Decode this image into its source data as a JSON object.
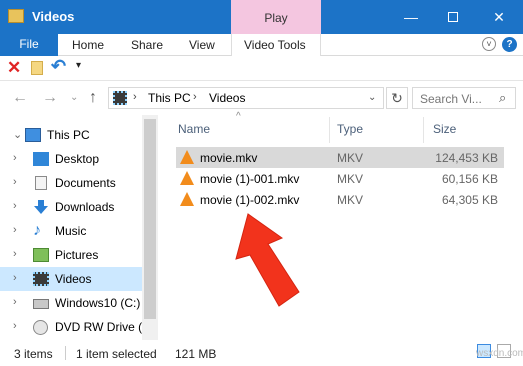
{
  "window": {
    "title": "Videos",
    "contextual_tab": "Play",
    "controls": {
      "minimize": "—",
      "close": "✕"
    }
  },
  "ribbon": {
    "tabs": [
      {
        "label": "File"
      },
      {
        "label": "Home"
      },
      {
        "label": "Share"
      },
      {
        "label": "View"
      },
      {
        "label": "Video Tools"
      }
    ],
    "expand": "˅",
    "help": "?"
  },
  "quick_access": {
    "icons": [
      "delete-icon",
      "new-folder-icon",
      "undo-icon",
      "customize-dropdown-icon"
    ],
    "delete": "✕",
    "undo": "↶",
    "dropdown": "▾"
  },
  "navigation": {
    "back": "←",
    "forward": "→",
    "recent": "⌄",
    "up": "↑",
    "breadcrumb": [
      "This PC",
      "Videos"
    ],
    "separator": "›",
    "refresh": "↻",
    "search_placeholder": "Search Vi...",
    "search_icon": "⌕"
  },
  "nav_pane": {
    "items": [
      {
        "label": "This PC",
        "caret": "⌄",
        "icon": "computer-icon",
        "selected": false
      },
      {
        "label": "Desktop",
        "caret": "›",
        "icon": "desktop-icon",
        "selected": false
      },
      {
        "label": "Documents",
        "caret": "›",
        "icon": "documents-icon",
        "selected": false
      },
      {
        "label": "Downloads",
        "caret": "›",
        "icon": "downloads-icon",
        "selected": false
      },
      {
        "label": "Music",
        "caret": "›",
        "icon": "music-icon",
        "selected": false
      },
      {
        "label": "Pictures",
        "caret": "›",
        "icon": "pictures-icon",
        "selected": false
      },
      {
        "label": "Videos",
        "caret": "›",
        "icon": "videos-icon",
        "selected": true
      },
      {
        "label": "Windows10 (C:)",
        "caret": "›",
        "icon": "drive-icon",
        "selected": false
      },
      {
        "label": "DVD RW Drive (D",
        "caret": "›",
        "icon": "dvd-icon",
        "selected": false
      }
    ]
  },
  "file_list": {
    "columns": {
      "name": "Name",
      "type": "Type",
      "size": "Size"
    },
    "sort_indicator": "^",
    "files": [
      {
        "name": "movie.mkv",
        "type": "MKV",
        "size": "124,453 KB",
        "selected": true
      },
      {
        "name": "movie (1)-001.mkv",
        "type": "MKV",
        "size": "60,156 KB",
        "selected": false
      },
      {
        "name": "movie (1)-002.mkv",
        "type": "MKV",
        "size": "64,305 KB",
        "selected": false
      }
    ]
  },
  "status_bar": {
    "item_count": "3 items",
    "selection": "1 item selected",
    "selection_size": "121 MB",
    "watermark": "wsxdn.com"
  },
  "colors": {
    "titlebar": "#1c73c7",
    "play_tab": "#f4c6e0",
    "selected_nav": "#cce8ff",
    "selected_row": "#d9d9d9",
    "annotation_arrow": "#f2331c",
    "vlc_orange": "#f28c1c"
  }
}
